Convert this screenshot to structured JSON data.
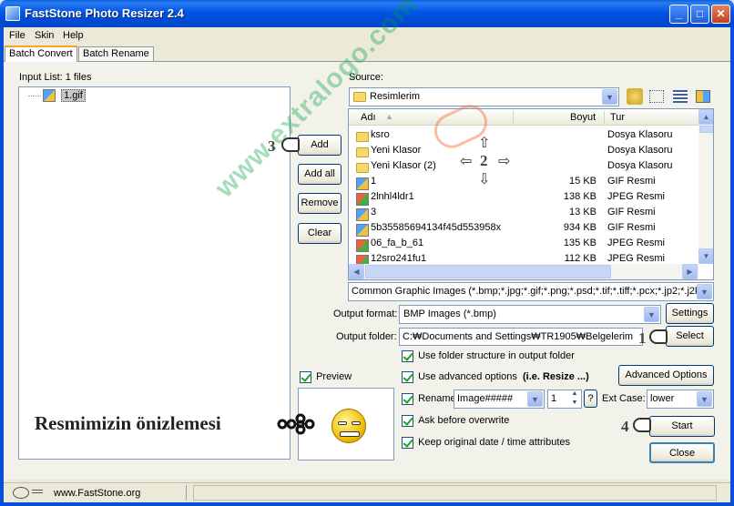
{
  "window": {
    "title": "FastStone Photo Resizer 2.4"
  },
  "menu": [
    "File",
    "Skin",
    "Help"
  ],
  "tabs": [
    "Batch Convert",
    "Batch Rename"
  ],
  "input_list": {
    "label": "Input List:  1 files",
    "items": [
      "1.gif"
    ]
  },
  "buttons": {
    "add": "Add",
    "add_all": "Add all",
    "remove": "Remove",
    "clear": "Clear",
    "settings": "Settings",
    "select": "Select",
    "advanced_options": "Advanced Options",
    "start": "Start",
    "close": "Close"
  },
  "source": {
    "label": "Source:",
    "folder": "Resimlerim",
    "columns": {
      "name": "Adı",
      "size": "Boyut",
      "type": "Tur"
    },
    "files": [
      {
        "name": "ksro",
        "size": "",
        "type": "Dosya Klasoru",
        "icon": "folder"
      },
      {
        "name": "Yeni Klasor",
        "size": "",
        "type": "Dosya Klasoru",
        "icon": "folder"
      },
      {
        "name": "Yeni Klasor (2)",
        "size": "",
        "type": "Dosya Klasoru",
        "icon": "folder"
      },
      {
        "name": "1",
        "size": "15 KB",
        "type": "GIF Resmi",
        "icon": "gif"
      },
      {
        "name": "2lnhl4ldr1",
        "size": "138 KB",
        "type": "JPEG Resmi",
        "icon": "jpg"
      },
      {
        "name": "3",
        "size": "13 KB",
        "type": "GIF Resmi",
        "icon": "gif"
      },
      {
        "name": "5b35585694134f45d553958x",
        "size": "934 KB",
        "type": "GIF Resmi",
        "icon": "gif"
      },
      {
        "name": "06_fa_b_61",
        "size": "135 KB",
        "type": "JPEG Resmi",
        "icon": "jpg"
      },
      {
        "name": "12sro241fu1",
        "size": "112 KB",
        "type": "JPEG Resmi",
        "icon": "jpg"
      }
    ],
    "filter": "Common Graphic Images (*.bmp;*.jpg;*.gif;*.png;*.psd;*.tif;*.tiff;*.pcx;*.jp2;*.j2k;*"
  },
  "output": {
    "format_label": "Output format:",
    "format": "BMP Images (*.bmp)",
    "folder_label": "Output folder:",
    "folder": "C:₩Documents and Settings₩TR1905₩Belgelerim"
  },
  "options": {
    "use_folder_structure": "Use folder structure in output folder",
    "use_advanced": "Use advanced options",
    "use_advanced_hint": "(i.e. Resize ...)",
    "rename": "Rename",
    "rename_pattern": "Image#####",
    "rename_start": "1",
    "help_q": "?",
    "ext_case_label": "Ext Case:",
    "ext_case": "lower",
    "ask_overwrite": "Ask before overwrite",
    "keep_date": "Keep original date / time attributes"
  },
  "preview": {
    "label": "Preview"
  },
  "status": {
    "url": "www.FastStone.org"
  },
  "annotations": {
    "n1": "1",
    "n2": "2",
    "n3": "3",
    "n4": "4",
    "preview_caption": "Resmimizin önizlemesi",
    "watermark": "www.extralogo.com"
  },
  "colors": {
    "title_bar": "#0054e3",
    "selection": "#316ac5",
    "checkmark": "#21a121"
  }
}
